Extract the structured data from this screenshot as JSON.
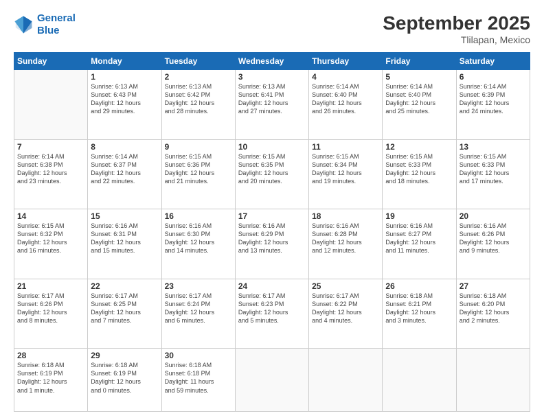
{
  "header": {
    "logo_line1": "General",
    "logo_line2": "Blue",
    "main_title": "September 2025",
    "subtitle": "Tlilapan, Mexico"
  },
  "weekdays": [
    "Sunday",
    "Monday",
    "Tuesday",
    "Wednesday",
    "Thursday",
    "Friday",
    "Saturday"
  ],
  "weeks": [
    [
      {
        "day": "",
        "info": ""
      },
      {
        "day": "1",
        "info": "Sunrise: 6:13 AM\nSunset: 6:43 PM\nDaylight: 12 hours\nand 29 minutes."
      },
      {
        "day": "2",
        "info": "Sunrise: 6:13 AM\nSunset: 6:42 PM\nDaylight: 12 hours\nand 28 minutes."
      },
      {
        "day": "3",
        "info": "Sunrise: 6:13 AM\nSunset: 6:41 PM\nDaylight: 12 hours\nand 27 minutes."
      },
      {
        "day": "4",
        "info": "Sunrise: 6:14 AM\nSunset: 6:40 PM\nDaylight: 12 hours\nand 26 minutes."
      },
      {
        "day": "5",
        "info": "Sunrise: 6:14 AM\nSunset: 6:40 PM\nDaylight: 12 hours\nand 25 minutes."
      },
      {
        "day": "6",
        "info": "Sunrise: 6:14 AM\nSunset: 6:39 PM\nDaylight: 12 hours\nand 24 minutes."
      }
    ],
    [
      {
        "day": "7",
        "info": "Sunrise: 6:14 AM\nSunset: 6:38 PM\nDaylight: 12 hours\nand 23 minutes."
      },
      {
        "day": "8",
        "info": "Sunrise: 6:14 AM\nSunset: 6:37 PM\nDaylight: 12 hours\nand 22 minutes."
      },
      {
        "day": "9",
        "info": "Sunrise: 6:15 AM\nSunset: 6:36 PM\nDaylight: 12 hours\nand 21 minutes."
      },
      {
        "day": "10",
        "info": "Sunrise: 6:15 AM\nSunset: 6:35 PM\nDaylight: 12 hours\nand 20 minutes."
      },
      {
        "day": "11",
        "info": "Sunrise: 6:15 AM\nSunset: 6:34 PM\nDaylight: 12 hours\nand 19 minutes."
      },
      {
        "day": "12",
        "info": "Sunrise: 6:15 AM\nSunset: 6:33 PM\nDaylight: 12 hours\nand 18 minutes."
      },
      {
        "day": "13",
        "info": "Sunrise: 6:15 AM\nSunset: 6:33 PM\nDaylight: 12 hours\nand 17 minutes."
      }
    ],
    [
      {
        "day": "14",
        "info": "Sunrise: 6:15 AM\nSunset: 6:32 PM\nDaylight: 12 hours\nand 16 minutes."
      },
      {
        "day": "15",
        "info": "Sunrise: 6:16 AM\nSunset: 6:31 PM\nDaylight: 12 hours\nand 15 minutes."
      },
      {
        "day": "16",
        "info": "Sunrise: 6:16 AM\nSunset: 6:30 PM\nDaylight: 12 hours\nand 14 minutes."
      },
      {
        "day": "17",
        "info": "Sunrise: 6:16 AM\nSunset: 6:29 PM\nDaylight: 12 hours\nand 13 minutes."
      },
      {
        "day": "18",
        "info": "Sunrise: 6:16 AM\nSunset: 6:28 PM\nDaylight: 12 hours\nand 12 minutes."
      },
      {
        "day": "19",
        "info": "Sunrise: 6:16 AM\nSunset: 6:27 PM\nDaylight: 12 hours\nand 11 minutes."
      },
      {
        "day": "20",
        "info": "Sunrise: 6:16 AM\nSunset: 6:26 PM\nDaylight: 12 hours\nand 9 minutes."
      }
    ],
    [
      {
        "day": "21",
        "info": "Sunrise: 6:17 AM\nSunset: 6:26 PM\nDaylight: 12 hours\nand 8 minutes."
      },
      {
        "day": "22",
        "info": "Sunrise: 6:17 AM\nSunset: 6:25 PM\nDaylight: 12 hours\nand 7 minutes."
      },
      {
        "day": "23",
        "info": "Sunrise: 6:17 AM\nSunset: 6:24 PM\nDaylight: 12 hours\nand 6 minutes."
      },
      {
        "day": "24",
        "info": "Sunrise: 6:17 AM\nSunset: 6:23 PM\nDaylight: 12 hours\nand 5 minutes."
      },
      {
        "day": "25",
        "info": "Sunrise: 6:17 AM\nSunset: 6:22 PM\nDaylight: 12 hours\nand 4 minutes."
      },
      {
        "day": "26",
        "info": "Sunrise: 6:18 AM\nSunset: 6:21 PM\nDaylight: 12 hours\nand 3 minutes."
      },
      {
        "day": "27",
        "info": "Sunrise: 6:18 AM\nSunset: 6:20 PM\nDaylight: 12 hours\nand 2 minutes."
      }
    ],
    [
      {
        "day": "28",
        "info": "Sunrise: 6:18 AM\nSunset: 6:19 PM\nDaylight: 12 hours\nand 1 minute."
      },
      {
        "day": "29",
        "info": "Sunrise: 6:18 AM\nSunset: 6:19 PM\nDaylight: 12 hours\nand 0 minutes."
      },
      {
        "day": "30",
        "info": "Sunrise: 6:18 AM\nSunset: 6:18 PM\nDaylight: 11 hours\nand 59 minutes."
      },
      {
        "day": "",
        "info": ""
      },
      {
        "day": "",
        "info": ""
      },
      {
        "day": "",
        "info": ""
      },
      {
        "day": "",
        "info": ""
      }
    ]
  ]
}
